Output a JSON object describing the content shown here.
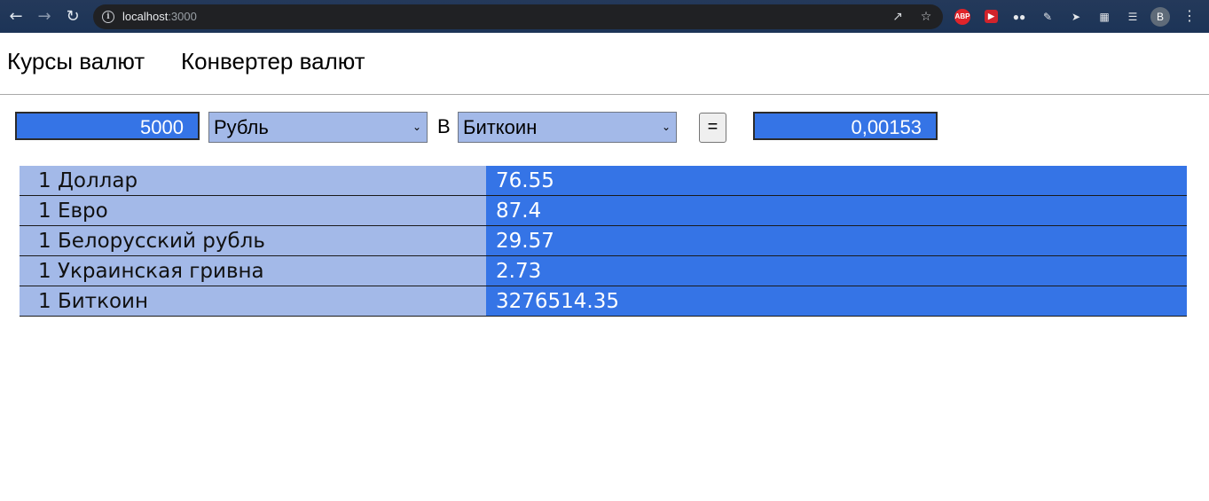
{
  "browser": {
    "url_host": "localhost",
    "url_port": ":3000",
    "profile_initial": "B",
    "extensions": {
      "abp_label": "ABP"
    }
  },
  "nav": {
    "links": [
      "Курсы валют",
      "Конвертер валют"
    ]
  },
  "converter": {
    "amount": "5000",
    "from_currency": "Рубль",
    "to_label": "В",
    "to_currency": "Биткоин",
    "equals_label": "=",
    "result": "0,00153"
  },
  "rates": [
    {
      "currency": "1 Доллар",
      "value": "76.55"
    },
    {
      "currency": "1 Евро",
      "value": "87.4"
    },
    {
      "currency": "1 Белорусский рубль",
      "value": "29.57"
    },
    {
      "currency": "1 Украинская гривна",
      "value": "2.73"
    },
    {
      "currency": "1 Биткоин",
      "value": "3276514.35"
    }
  ],
  "colors": {
    "accent_blue": "#3574e6",
    "light_blue": "#a3b9e8",
    "chrome_bg": "#1c3457"
  }
}
